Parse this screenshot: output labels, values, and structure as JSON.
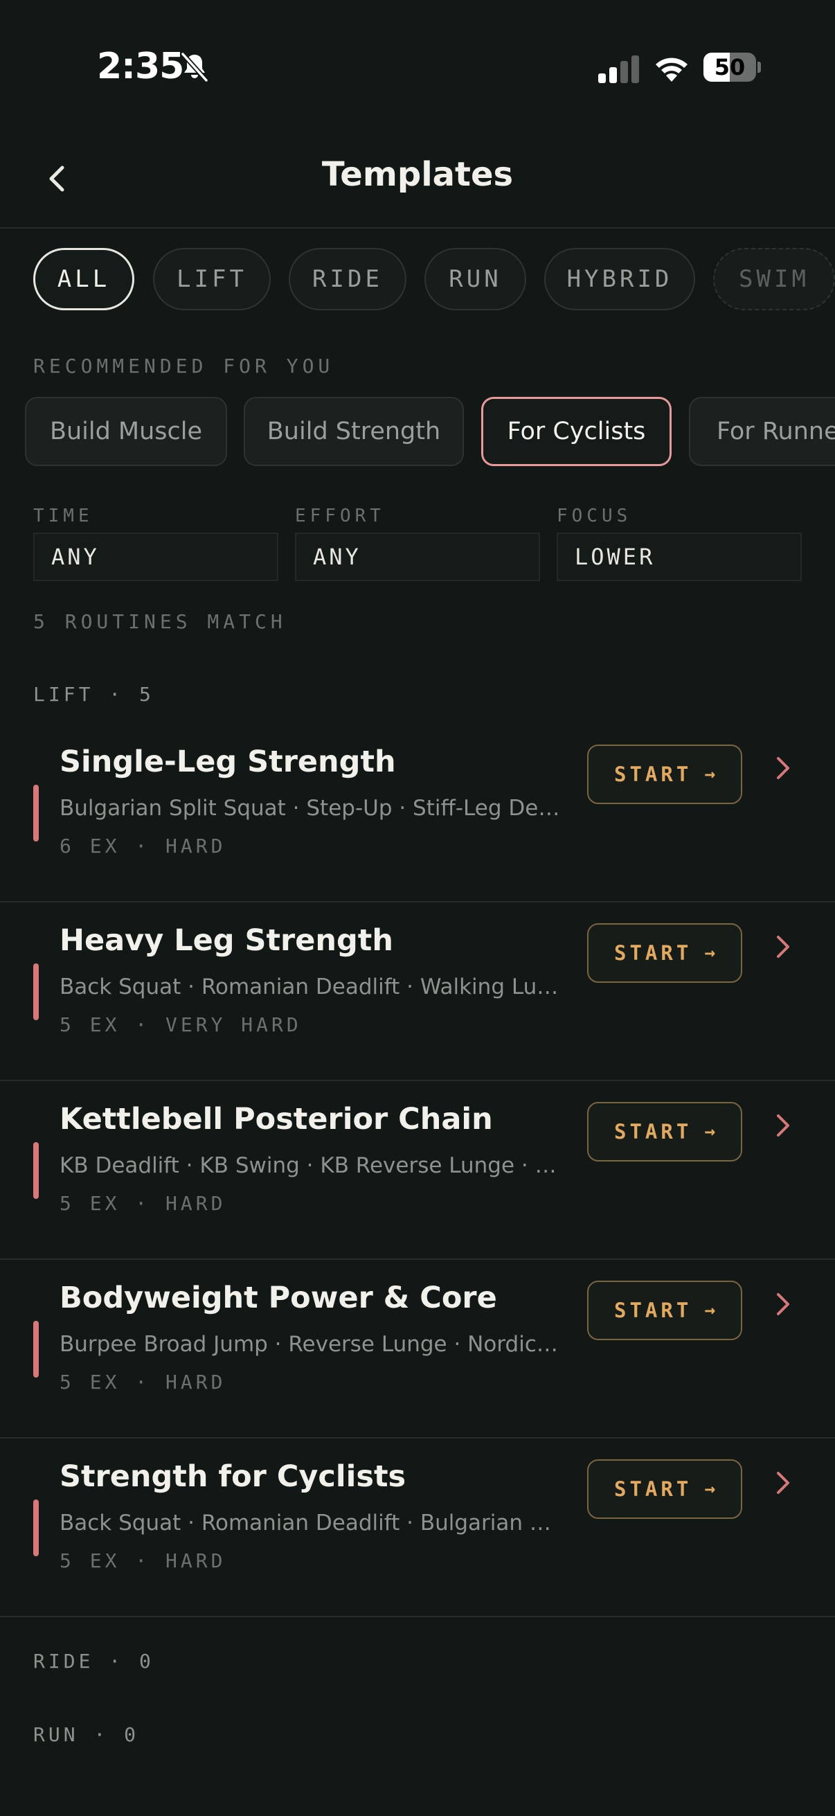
{
  "status_bar": {
    "time": "2:35",
    "battery": "50",
    "battery_level": 0.5
  },
  "header": {
    "title": "Templates"
  },
  "categories": [
    {
      "label": "ALL",
      "active": true
    },
    {
      "label": "LIFT"
    },
    {
      "label": "RIDE"
    },
    {
      "label": "RUN"
    },
    {
      "label": "HYBRID"
    },
    {
      "label": "SWIM"
    }
  ],
  "recommended": {
    "label": "RECOMMENDED FOR YOU",
    "chips": [
      {
        "label": "Build Muscle"
      },
      {
        "label": "Build Strength"
      },
      {
        "label": "For Cyclists",
        "active": true
      },
      {
        "label": "For Runners"
      }
    ]
  },
  "filters": [
    {
      "label": "TIME",
      "value": "ANY"
    },
    {
      "label": "EFFORT",
      "value": "ANY"
    },
    {
      "label": "FOCUS",
      "value": "LOWER"
    }
  ],
  "match_count": "5 ROUTINES MATCH",
  "groups": {
    "lift": "LIFT · 5",
    "ride": "RIDE · 0",
    "run": "RUN · 0"
  },
  "start_label": "START",
  "start_arrow": "→",
  "routines": [
    {
      "title": "Single-Leg Strength",
      "exercises": "Bulgarian Split Squat · Step-Up · Stiff-Leg Dea...",
      "meta": "6 EX · HARD"
    },
    {
      "title": "Heavy Leg Strength",
      "exercises": "Back Squat · Romanian Deadlift · Walking Lung...",
      "meta": "5 EX · VERY HARD"
    },
    {
      "title": "Kettlebell Posterior Chain",
      "exercises": "KB Deadlift · KB Swing · KB Reverse Lunge · Glut...",
      "meta": "5 EX · HARD"
    },
    {
      "title": "Bodyweight Power & Core",
      "exercises": "Burpee Broad Jump · Reverse Lunge · Nordic H...",
      "meta": "5 EX · HARD"
    },
    {
      "title": "Strength for Cyclists",
      "exercises": "Back Squat · Romanian Deadlift · Bulgarian Spli...",
      "meta": "5 EX · HARD"
    }
  ],
  "colors": {
    "background": "#111815",
    "accent_start": "#E3A95E",
    "accent_rose": "#D8787A",
    "active_chip_border": "#E89A98"
  }
}
